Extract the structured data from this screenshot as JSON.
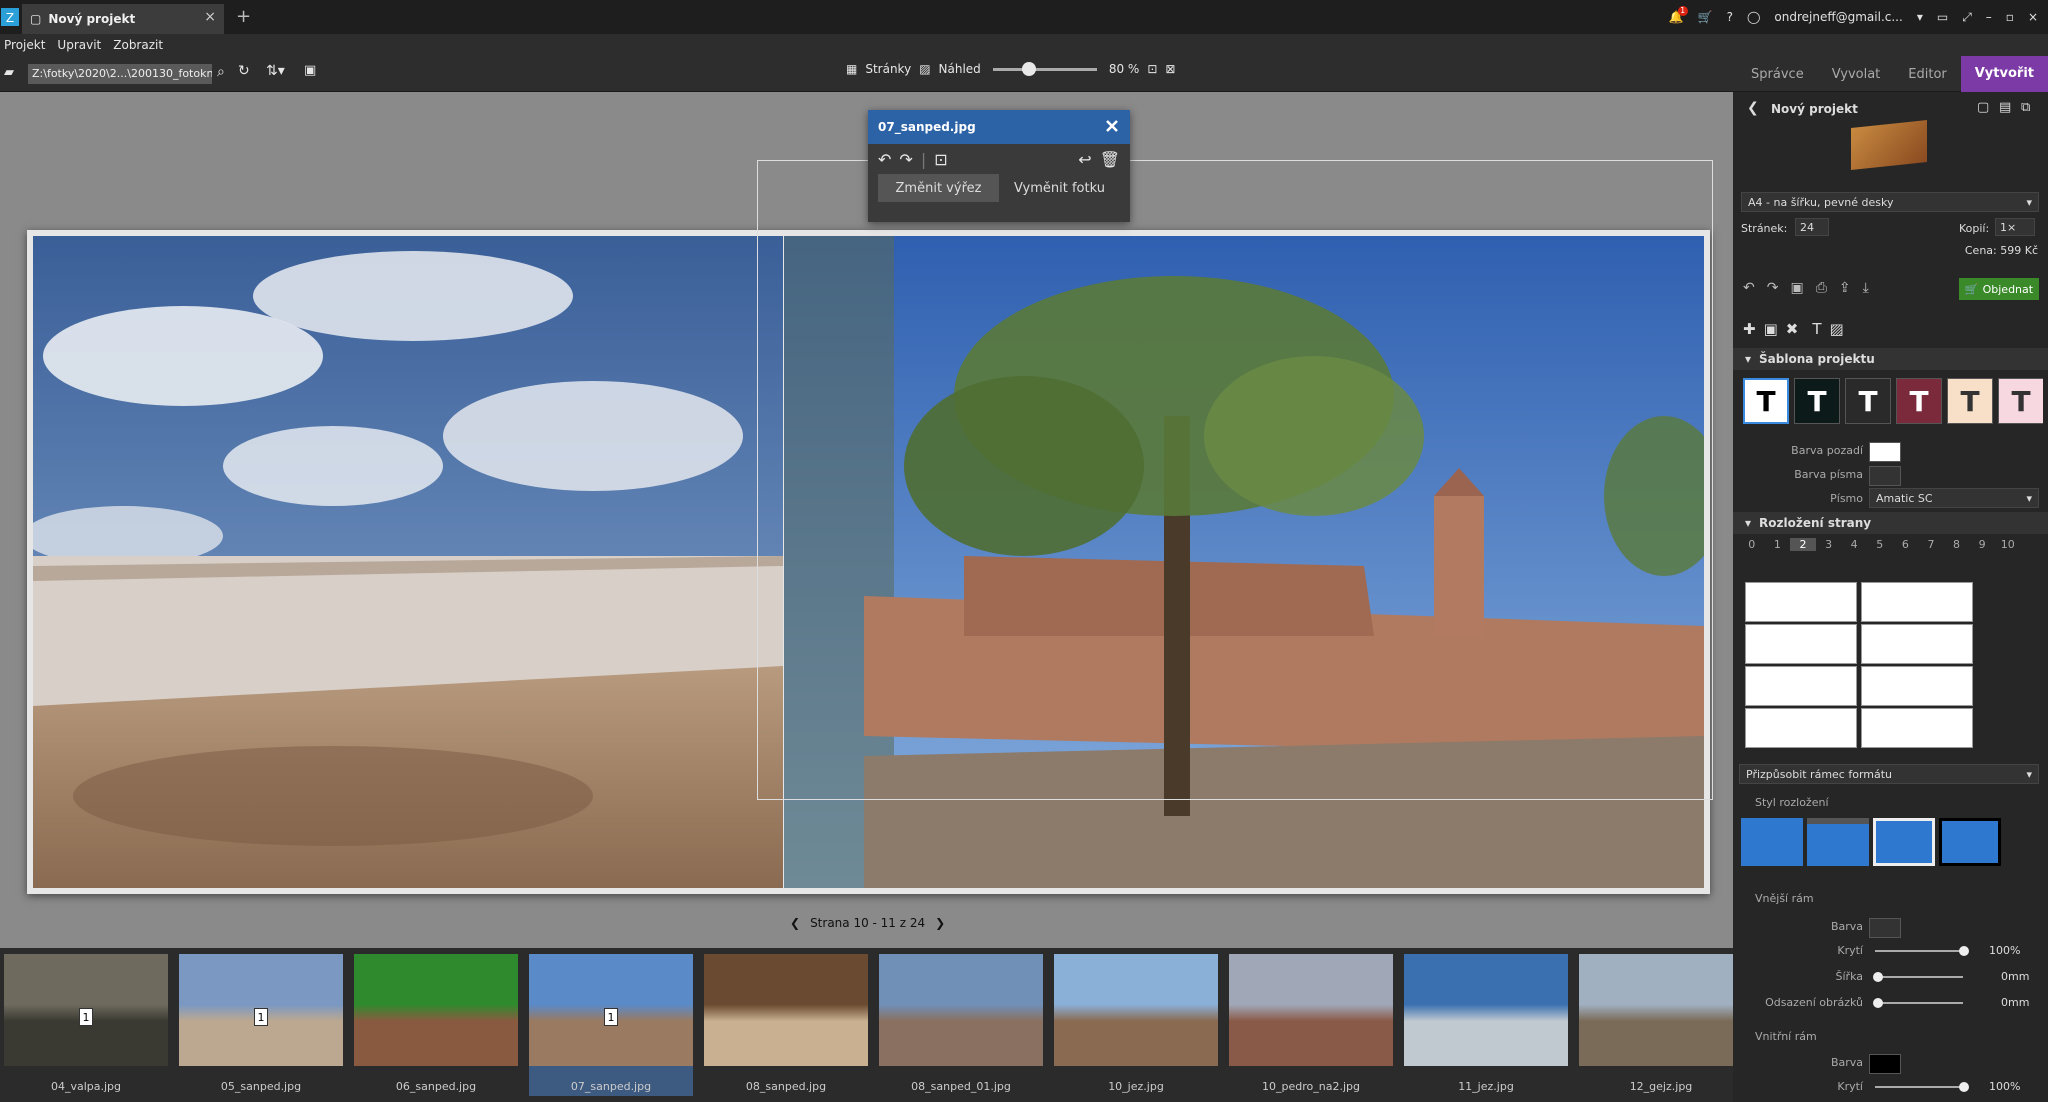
{
  "tab": {
    "title": "Nový projekt"
  },
  "header": {
    "email": "ondrejneff@gmail.c...",
    "notif_count": "1"
  },
  "menu": [
    "Projekt",
    "Upravit",
    "Zobrazit"
  ],
  "toolbar": {
    "path": "Z:\\fotky\\2020\\2...\\200130_fotokniha",
    "pages_label": "Stránky",
    "preview_label": "Náhled",
    "zoom": "80 %",
    "zoom_value": 0.8
  },
  "modes": [
    "Správce",
    "Vyvolat",
    "Editor",
    "Vytvořit"
  ],
  "popup": {
    "filename": "07_sanped.jpg",
    "btn_crop": "Změnit výřez",
    "btn_replace": "Vyměnit fotku"
  },
  "pager": {
    "text": "Strana 10 - 11 z 24"
  },
  "filmstrip": [
    {
      "name": "04_valpa.jpg",
      "badge": "1",
      "colors": [
        "#6e6a5e",
        "#3a3a32"
      ]
    },
    {
      "name": "05_sanped.jpg",
      "badge": "1",
      "colors": [
        "#7a98c2",
        "#bca890"
      ]
    },
    {
      "name": "06_sanped.jpg",
      "badge": "",
      "colors": [
        "#2f8a2e",
        "#8a5a40"
      ]
    },
    {
      "name": "07_sanped.jpg",
      "badge": "1",
      "colors": [
        "#5a8ac8",
        "#9a7a60"
      ]
    },
    {
      "name": "08_sanped.jpg",
      "badge": "",
      "colors": [
        "#6a4a30",
        "#c8b090"
      ]
    },
    {
      "name": "08_sanped_01.jpg",
      "badge": "",
      "colors": [
        "#7090b8",
        "#8a7060"
      ]
    },
    {
      "name": "10_jez.jpg",
      "badge": "",
      "colors": [
        "#8ab0d8",
        "#8a6a50"
      ]
    },
    {
      "name": "10_pedro_na2.jpg",
      "badge": "",
      "colors": [
        "#a0a8b8",
        "#8a5a48"
      ]
    },
    {
      "name": "11_jez.jpg",
      "badge": "",
      "colors": [
        "#3a70b0",
        "#c0c8d0"
      ]
    },
    {
      "name": "12_gejz.jpg",
      "badge": "",
      "colors": [
        "#a0b0c0",
        "#7a6a58"
      ]
    }
  ],
  "panel": {
    "project_title": "Nový projekt",
    "format": "A4 - na šířku, pevné desky",
    "pages_label": "Stránek:",
    "pages_value": "24",
    "copies_label": "Kopií:",
    "copies_value": "1×",
    "price": "Cena: 599 Kč",
    "order_label": "Objednat",
    "template_section": "Šablona projektu",
    "bg_color_label": "Barva pozadí",
    "font_color_label": "Barva písma",
    "font_label": "Písmo",
    "font_value": "Amatic SC",
    "layout_section": "Rozložení strany",
    "layout_counts": [
      "0",
      "1",
      "2",
      "3",
      "4",
      "5",
      "6",
      "7",
      "8",
      "9",
      "10"
    ],
    "fit_label": "Přizpůsobit rámec formátu",
    "style_label": "Styl rozložení",
    "outer_frame": "Vnější rám",
    "inner_frame": "Vnitřní rám",
    "color_label": "Barva",
    "opacity_label": "Krytí",
    "width_label": "Šířka",
    "offset_label": "Odsazení obrázků",
    "outer_opacity": "100%",
    "outer_width": "0mm",
    "outer_offset": "0mm",
    "inner_opacity": "100%"
  }
}
